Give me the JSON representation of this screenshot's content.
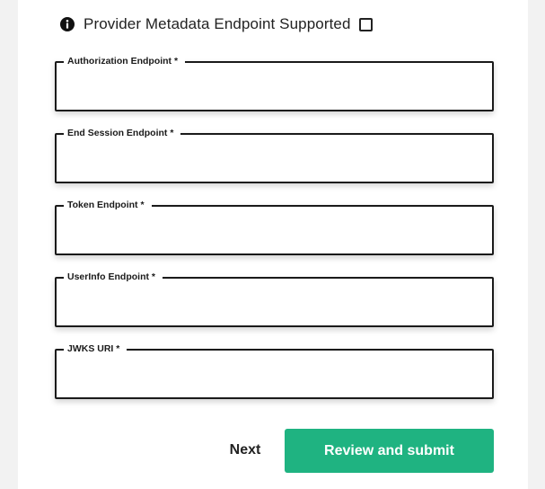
{
  "metadata_option": {
    "label": "Provider Metadata Endpoint Supported",
    "checked": false,
    "icon": "info-icon"
  },
  "fields": [
    {
      "label": "Authorization Endpoint *",
      "value": ""
    },
    {
      "label": "End Session Endpoint *",
      "value": ""
    },
    {
      "label": "Token Endpoint *",
      "value": ""
    },
    {
      "label": "UserInfo Endpoint *",
      "value": ""
    },
    {
      "label": "JWKS URI *",
      "value": ""
    }
  ],
  "actions": {
    "next_label": "Next",
    "submit_label": "Review and submit"
  },
  "colors": {
    "primary": "#1fb381",
    "border": "#1a1a1a",
    "text": "#222222"
  }
}
